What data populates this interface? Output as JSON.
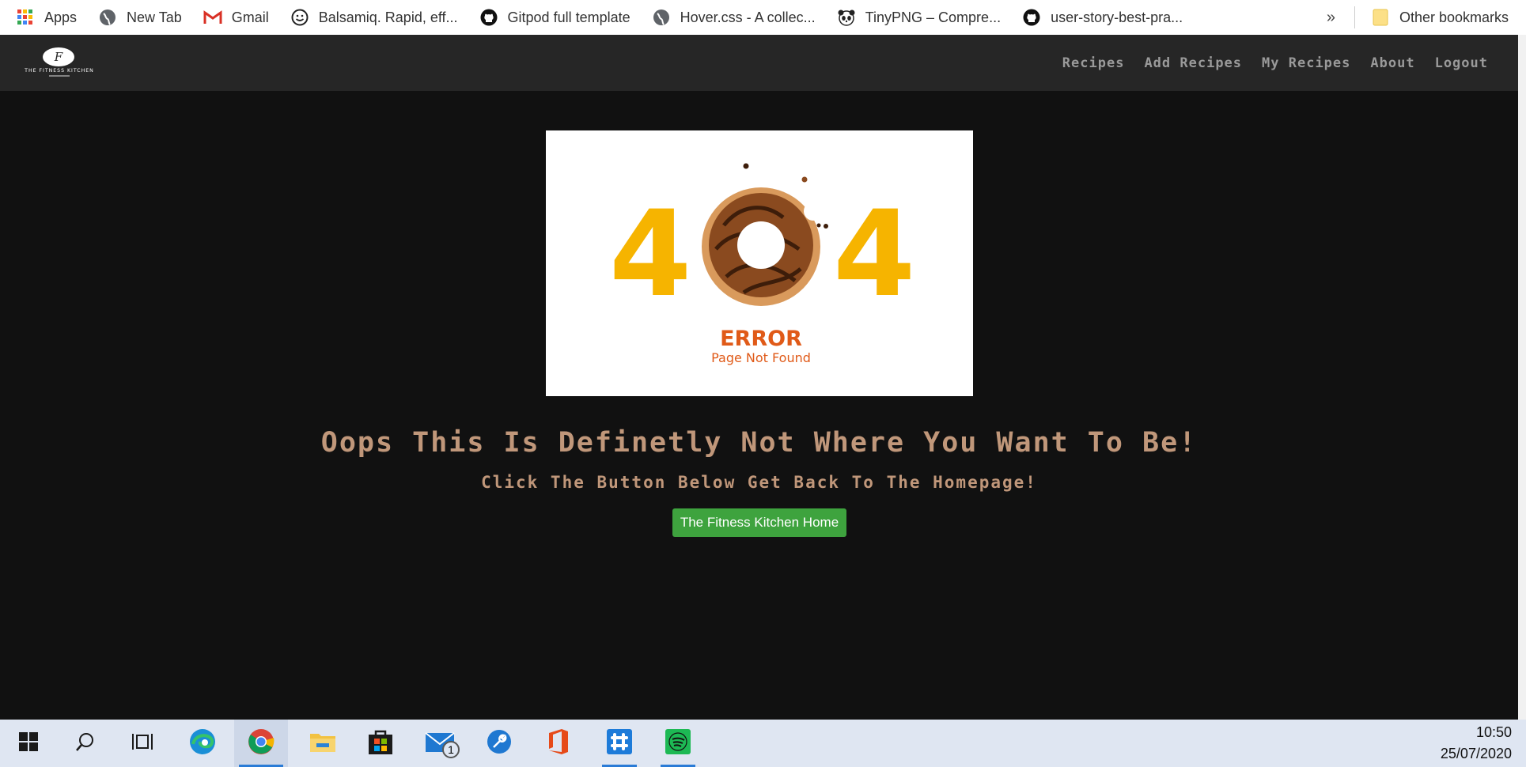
{
  "bookmarks": [
    {
      "label": "Apps",
      "icon": "apps-grid-icon"
    },
    {
      "label": "New Tab",
      "icon": "globe-icon"
    },
    {
      "label": "Gmail",
      "icon": "gmail-icon"
    },
    {
      "label": "Balsamiq. Rapid, eff...",
      "icon": "smiley-icon"
    },
    {
      "label": "Gitpod full template",
      "icon": "github-icon"
    },
    {
      "label": "Hover.css - A collec...",
      "icon": "globe-icon"
    },
    {
      "label": "TinyPNG – Compre...",
      "icon": "panda-icon"
    },
    {
      "label": "user-story-best-pra...",
      "icon": "github-icon"
    }
  ],
  "bookmarks_more": "»",
  "other_bookmarks": "Other bookmarks",
  "brand": {
    "logo_letter": "F",
    "logo_text": "THE FITNESS KITCHEN"
  },
  "nav": {
    "recipes": "Recipes",
    "add_recipes": "Add Recipes",
    "my_recipes": "My Recipes",
    "about": "About",
    "logout": "Logout"
  },
  "error_image": {
    "left_digit": "4",
    "right_digit": "4",
    "title": "ERROR",
    "subtitle": "Page Not Found"
  },
  "main": {
    "heading": "Oops This Is Definetly Not Where You Want To Be!",
    "subheading": "Click The Button Below Get Back To The Homepage!",
    "button": "The Fitness Kitchen Home"
  },
  "taskbar": {
    "mail_badge": "1",
    "time": "10:50",
    "date": "25/07/2020"
  },
  "colors": {
    "accent_button": "#3ea33e",
    "heading": "#c0977a",
    "digits": "#f6b400",
    "error_text": "#e05a18",
    "taskbar": "#dfe6f2"
  }
}
